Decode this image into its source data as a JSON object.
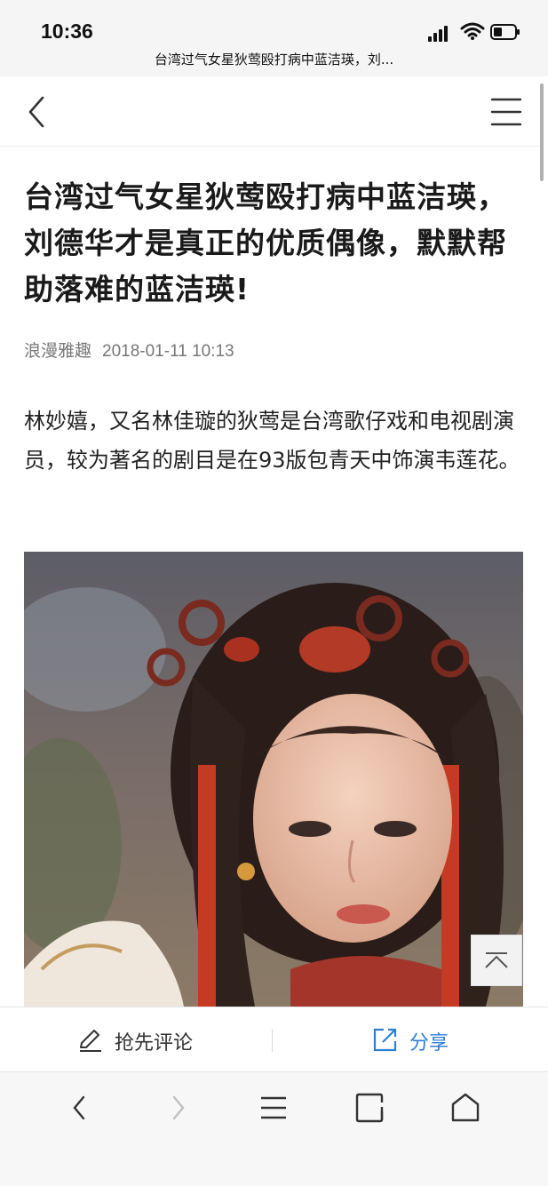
{
  "status": {
    "time": "10:36",
    "page_title": "台湾过气女星狄莺殴打病中蓝洁瑛，刘..."
  },
  "nav": {
    "back_icon": "chevron-left-icon",
    "menu_icon": "hamburger-menu-icon"
  },
  "article": {
    "title": "台湾过气女星狄莺殴打病中蓝洁瑛，刘德华才是真正的优质偶像，默默帮助落难的蓝洁瑛!",
    "author": "浪漫雅趣",
    "date": "2018-01-11 10:13",
    "paragraph": "林妙嬉，又名林佳璇的狄莺是台湾歌仔戏和电视剧演员，较为著名的剧目是在93版包青天中饰演韦莲花。"
  },
  "actions": {
    "comment_label": "抢先评论",
    "share_label": "分享"
  },
  "colors": {
    "accent": "#2e7fd6",
    "title": "#1a1a1a",
    "meta": "#777777"
  }
}
